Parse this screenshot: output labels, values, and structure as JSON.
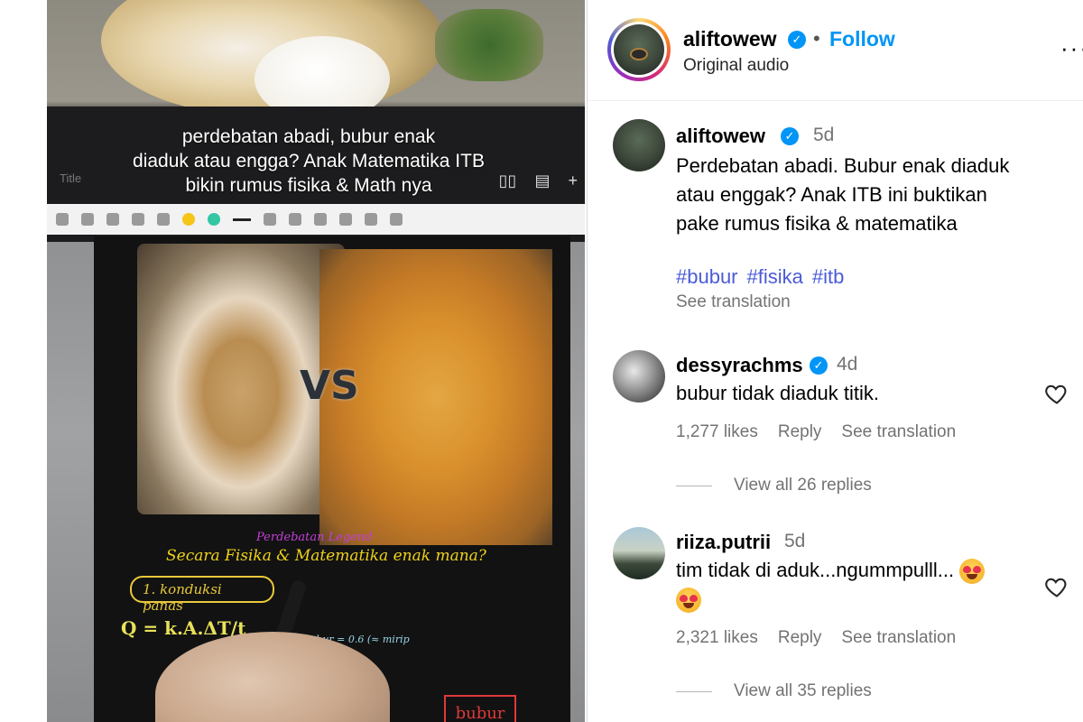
{
  "video": {
    "caption_line1": "perdebatan abadi, bubur enak",
    "caption_line2": "diaduk atau engga? Anak Matematika ITB",
    "caption_line3": "bikin rumus fisika & Math nya",
    "tablet_title": "Title",
    "vs_label": "VS",
    "handwriting": {
      "heading": "Perdebatan Legend",
      "subtitle": "Secara Fisika & Matematika enak mana?",
      "item1": "1. konduksi panas",
      "formula": "Q = k.A.ΔT/t",
      "note": "k bubur = 0.6 (≈ mirip air kaldu)",
      "box": "bubur"
    }
  },
  "post": {
    "author": {
      "username": "aliftowew",
      "verified": true,
      "follow_label": "Follow",
      "audio": "Original audio",
      "more_icon": "more-horizontal-icon"
    },
    "caption": {
      "username": "aliftowew",
      "time": "5d",
      "text_line1": "Perdebatan abadi. Bubur enak diaduk",
      "text_line2": "atau enggak? Anak ITB ini buktikan",
      "text_line3": "pake rumus fisika & matematika",
      "hashtags": [
        "#bubur",
        "#fisika",
        "#itb"
      ],
      "see_translation": "See translation"
    },
    "comments": [
      {
        "username": "dessyrachms",
        "verified": true,
        "time": "4d",
        "text": "bubur tidak diaduk titik.",
        "likes": "1,277 likes",
        "reply": "Reply",
        "see_translation": "See translation",
        "view_replies": "View all 26 replies"
      },
      {
        "username": "riiza.putrii",
        "verified": false,
        "time": "5d",
        "text": "tim tidak di aduk...ngummpulll...",
        "emoji": "smiling-face-with-heart-eyes",
        "likes": "2,321 likes",
        "reply": "Reply",
        "see_translation": "See translation",
        "view_replies": "View all 35 replies"
      }
    ],
    "colors": {
      "follow": "#0095f6",
      "verified": "#0095f6",
      "hashtag": "#4a5bd8",
      "muted": "#737373"
    }
  }
}
